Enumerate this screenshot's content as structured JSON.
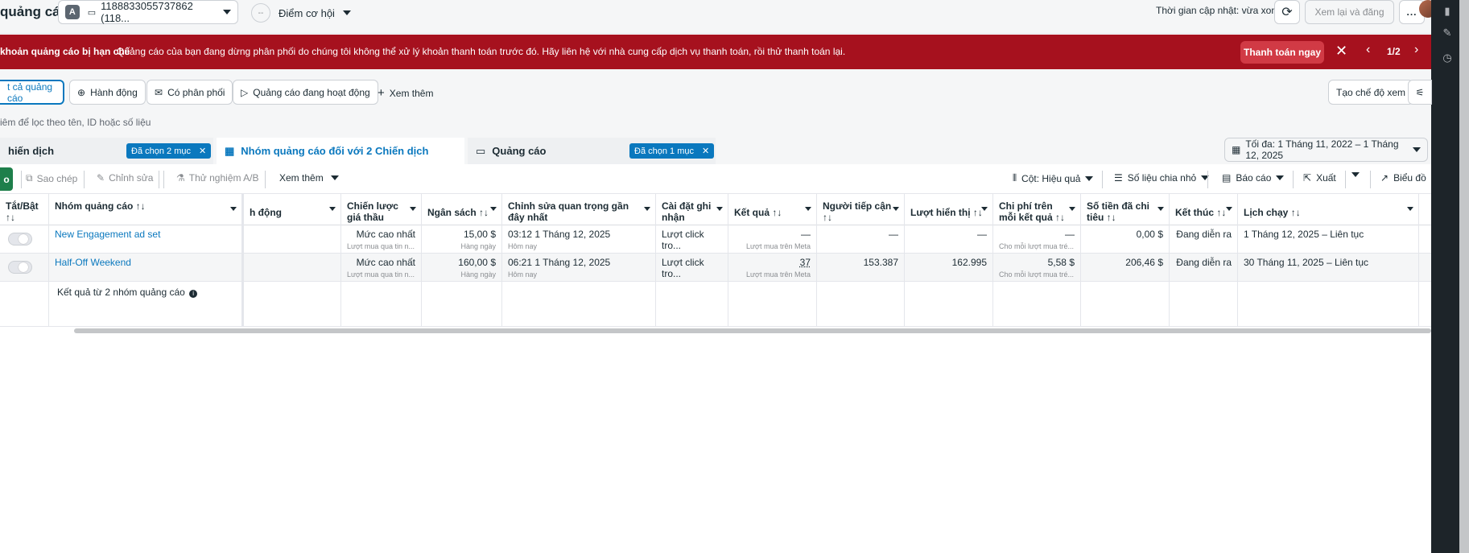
{
  "header": {
    "title": "quảng cáo",
    "account_badge": "A",
    "account_id": "1188833055737862 (118...",
    "opportunity_label": "Điểm cơ hội",
    "updated_text": "Thời gian cập nhật: vừa xong",
    "review_publish_label": "Xem lại và đăng",
    "more_label": "..."
  },
  "banner": {
    "title": "khoản quảng cáo bị hạn chế",
    "text": "Quảng cáo của bạn đang dừng phân phối do chúng tôi không thể xử lý khoản thanh toán trước đó. Hãy liên hệ với nhà cung cấp dịch vụ thanh toán, rồi thử thanh toán lại.",
    "pay_now_label": "Thanh toán ngay",
    "pager": "1/2"
  },
  "toolbar": {
    "all_ads_label": "t cả quảng cáo",
    "actions_label": "Hành động",
    "delivery_label": "Có phân phối",
    "active_ads_label": "Quảng cáo đang hoạt động",
    "see_more_label": "Xem thêm",
    "create_view_label": "Tạo chế độ xem"
  },
  "search": {
    "placeholder": "iêm để lọc theo tên, ID hoặc số liệu"
  },
  "level_tabs": {
    "campaigns_label": "hiến dịch",
    "campaigns_chip": "Đã chọn 2 mục",
    "adsets_label": "Nhóm quảng cáo đối với 2 Chiến dịch",
    "ads_label": "Quảng cáo",
    "ads_chip": "Đã chọn 1 mục",
    "date_range": "Tối đa: 1 Tháng 11, 2022 – 1 Tháng 12, 2025"
  },
  "actions": {
    "create_label": "o",
    "duplicate_label": "Sao chép",
    "edit_label": "Chỉnh sửa",
    "ab_test_label": "Thử nghiệm A/B",
    "see_more_label": "Xem thêm",
    "columns_label": "Cột: Hiệu quả",
    "breakdown_label": "Số liệu chia nhỏ",
    "reports_label": "Báo cáo",
    "export_label": "Xuất",
    "charts_label": "Biểu đồ"
  },
  "table": {
    "headers": {
      "toggle": "Tắt/Bật",
      "toggle_sort": "↑↓",
      "name": "Nhóm quảng cáo ↑↓",
      "delivery": "h động",
      "bid_strategy": "Chiến lược giá thầu",
      "budget": "Ngân sách ↑↓",
      "last_edit": "Chỉnh sửa quan trọng gần đây nhất",
      "attribution": "Cài đặt ghi nhận",
      "results": "Kết quả ↑↓",
      "reach": "Người tiếp cận",
      "reach_sort": "↑↓",
      "impressions": "Lượt hiển thị ↑↓",
      "cost_per_result": "Chi phí trên mỗi kết quả ↑↓",
      "amount_spent": "Số tiền đã chi tiêu ↑↓",
      "ends": "Kết thúc ↑↓",
      "schedule": "Lịch chạy ↑↓"
    },
    "rows": [
      {
        "name": "New Engagement ad set",
        "bid": "Mức cao nhất",
        "bid_sub": "Lượt mua qua tin n...",
        "budget": "15,00 $",
        "budget_sub": "Hàng ngày",
        "last_edit": "03:12 1 Tháng 12, 2025",
        "last_edit_sub": "Hôm nay",
        "attribution": "Lượt click tro...",
        "results": "—",
        "results_sub": "Lượt mua trên Meta",
        "reach": "—",
        "impressions": "—",
        "cpr": "—",
        "cpr_sub": "Cho mỗi lượt mua tré...",
        "spent": "0,00 $",
        "ends": "Đang diễn ra",
        "schedule": "1 Tháng 12, 2025 – Liên tục"
      },
      {
        "name": "Half-Off Weekend",
        "bid": "Mức cao nhất",
        "bid_sub": "Lượt mua qua tin n...",
        "budget": "160,00 $",
        "budget_sub": "Hàng ngày",
        "last_edit": "06:21 1 Tháng 12, 2025",
        "last_edit_sub": "Hôm nay",
        "attribution": "Lượt click tro...",
        "results": "37",
        "results_sub": "Lượt mua trên Meta",
        "reach": "153.387",
        "impressions": "162.995",
        "cpr": "5,58 $",
        "cpr_sub": "Cho mỗi lượt mua tré...",
        "spent": "206,46 $",
        "ends": "Đang diễn ra",
        "schedule": "30 Tháng 11, 2025 – Liên tục"
      }
    ],
    "summary_label": "Kết quả từ 2 nhóm quảng cáo"
  },
  "colors": {
    "banner": "#a6111e",
    "accent": "#0a78be",
    "create": "#1e7f4b"
  }
}
